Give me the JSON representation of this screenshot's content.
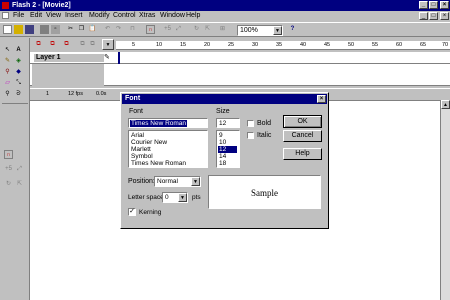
{
  "app": {
    "title": "Flash 2 - [Movie2]"
  },
  "menu": [
    "File",
    "Edit",
    "View",
    "Insert",
    "Modify",
    "Control",
    "Xtras",
    "Window",
    "Help"
  ],
  "toolbar": {
    "zoom": "100%"
  },
  "ruler": [
    "5",
    "10",
    "15",
    "20",
    "25",
    "30",
    "35",
    "40",
    "45",
    "50",
    "55",
    "60",
    "65",
    "70"
  ],
  "timeline": {
    "layer_name": "Layer 1",
    "frame": "1",
    "fps": "12 fps",
    "time": "0.0s"
  },
  "font_dialog": {
    "title": "Font",
    "font_label": "Font",
    "font_value": "Times New Roman",
    "fonts": [
      "Arial",
      "Courier New",
      "Marlett",
      "Symbol",
      "Times New Roman"
    ],
    "size_label": "Size",
    "size_value": "12",
    "sizes": [
      "9",
      "10",
      "12",
      "14",
      "18"
    ],
    "selected_size": "12",
    "bold_label": "Bold",
    "italic_label": "Italic",
    "ok_label": "OK",
    "cancel_label": "Cancel",
    "help_label": "Help",
    "position_label": "Position:",
    "position_value": "Normal",
    "letter_space_label": "Letter space",
    "letter_space_value": "0",
    "letter_space_unit": "pts",
    "kerning_label": "Kerning",
    "sample_text": "Sample"
  }
}
